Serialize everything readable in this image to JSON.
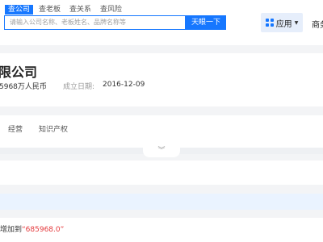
{
  "search": {
    "tabs": [
      "查公司",
      "查老板",
      "查关系",
      "查风险"
    ],
    "placeholder": "请输入公司名称、老板姓名、品牌名称等",
    "button": "天眼一下"
  },
  "header": {
    "app_label": "应用",
    "business_label": "商务"
  },
  "company": {
    "name": "限公司",
    "capital": "5968万人民币",
    "established_label": "成立日期:",
    "established_value": "2016-12-09"
  },
  "nav_tabs": [
    "经营",
    "知识产权"
  ],
  "change": {
    "prefix": "增加到",
    "value": "“685968.0”"
  },
  "colors": {
    "accent": "#1677ff",
    "highlight": "#e4393c"
  }
}
